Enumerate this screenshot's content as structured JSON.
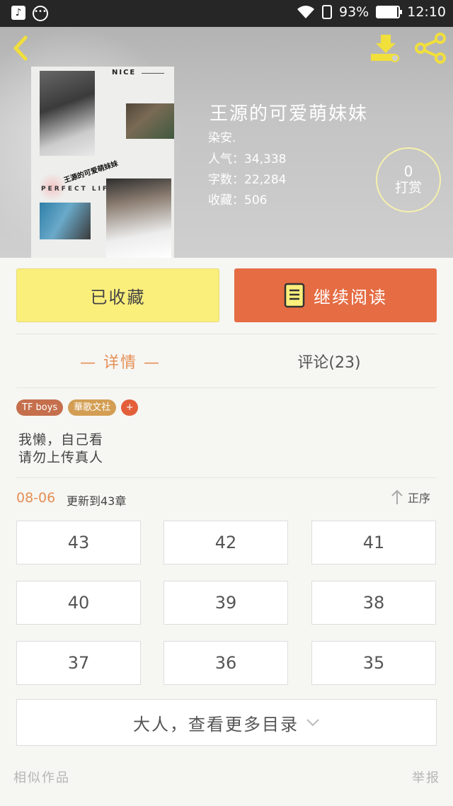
{
  "status_bar": {
    "battery": "93%",
    "battery_level": 0.93,
    "time": "12:10",
    "icons": [
      "app-notification-icon",
      "chat-bubble-icon",
      "wifi-icon",
      "sim-icon",
      "battery-icon"
    ]
  },
  "header": {
    "icons": [
      "back-arrow-icon",
      "download-icon",
      "share-icon"
    ]
  },
  "cover": {
    "top_text": "NICE",
    "title_text": "王源的可爱萌妹妹",
    "perfect_text": "PERFECT LIFE"
  },
  "book": {
    "title": "王源的可爱萌妹妹",
    "author": "染安.",
    "popularity": "人气：34,338",
    "word_count": "字数：22,284",
    "favorites": "收藏：506"
  },
  "tip": {
    "count": "0",
    "label": "打赏"
  },
  "actions": {
    "favorite_label": "已收藏",
    "read_label": "继续阅读"
  },
  "tabs": {
    "detail": "— 详情 —",
    "comments": "评论(23)"
  },
  "tags": [
    "TF boys",
    "華歌文社",
    "+"
  ],
  "description": {
    "line1": "我懒，自己看",
    "line2": "请勿上传真人"
  },
  "update": {
    "date": "08-06",
    "text": "更新到43章",
    "sort_label": "正序"
  },
  "chapters": [
    "43",
    "42",
    "41",
    "40",
    "39",
    "38",
    "37",
    "36",
    "35"
  ],
  "more_label": "大人，查看更多目录",
  "footer": {
    "similar": "相似作品",
    "report": "举报"
  },
  "colors": {
    "accent_orange": "#e56c43",
    "favorite_yellow": "#fbef7c",
    "tab_active": "#e58f55",
    "tag_red": "#c56f4d",
    "tag_gold": "#d39e53"
  }
}
